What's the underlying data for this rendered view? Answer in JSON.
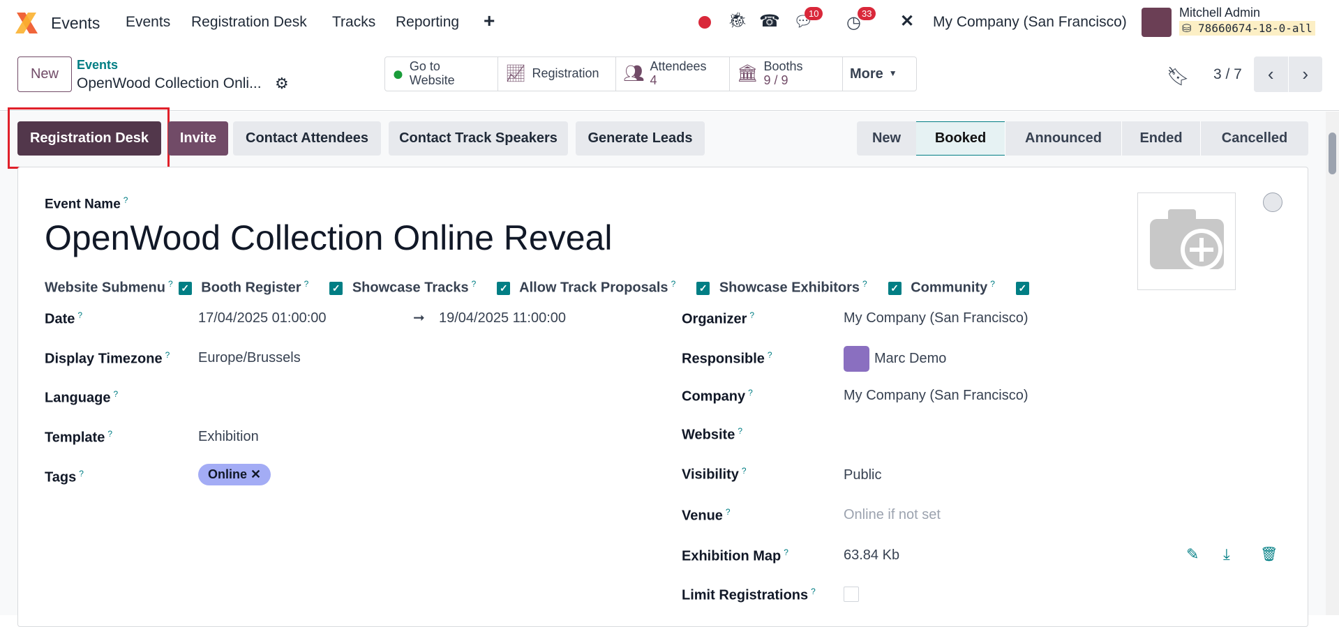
{
  "nav": {
    "app": "Events",
    "menu": [
      "Events",
      "Registration Desk",
      "Tracks",
      "Reporting"
    ],
    "plus": "+",
    "chat_badge": "10",
    "activity_badge": "33",
    "company": "My Company (San Francisco)",
    "user": "Mitchell Admin",
    "db": "78660674-18-0-all"
  },
  "control": {
    "new_label": "New",
    "breadcrumb_parent": "Events",
    "breadcrumb_current": "OpenWood Collection Onli...",
    "pager": "3 / 7",
    "smart": [
      {
        "label": "Go to",
        "label2": "Website",
        "icon": "globe-icon"
      },
      {
        "label": "Registration",
        "icon": "chart-icon"
      },
      {
        "label": "Attendees",
        "value": "4",
        "icon": "users-icon"
      },
      {
        "label": "Booths",
        "value": "9 / 9",
        "icon": "bank-icon"
      },
      {
        "label": "More"
      }
    ]
  },
  "actions": {
    "registration_desk": "Registration Desk",
    "invite": "Invite",
    "contact_attendees": "Contact Attendees",
    "contact_track_speakers": "Contact Track Speakers",
    "generate_leads": "Generate Leads"
  },
  "status": {
    "stages": [
      "New",
      "Booked",
      "Announced",
      "Ended",
      "Cancelled"
    ],
    "active": "Booked"
  },
  "form": {
    "event_name_label": "Event Name",
    "event_name": "OpenWood Collection Online Reveal",
    "checks": [
      "Website Submenu",
      "Booth Register",
      "Showcase Tracks",
      "Allow Track Proposals",
      "Showcase Exhibitors",
      "Community"
    ],
    "left": [
      {
        "label": "Date",
        "value": "17/04/2025 01:00:00",
        "value2": "19/04/2025 11:00:00"
      },
      {
        "label": "Display Timezone",
        "value": "Europe/Brussels"
      },
      {
        "label": "Language",
        "value": ""
      },
      {
        "label": "Template",
        "value": "Exhibition"
      },
      {
        "label": "Tags",
        "value": "Online"
      }
    ],
    "right": [
      {
        "label": "Organizer",
        "value": "My Company (San Francisco)"
      },
      {
        "label": "Responsible",
        "value": "Marc Demo"
      },
      {
        "label": "Company",
        "value": "My Company (San Francisco)"
      },
      {
        "label": "Website",
        "value": ""
      },
      {
        "label": "Visibility",
        "value": "Public"
      },
      {
        "label": "Venue",
        "value": "Online if not set"
      },
      {
        "label": "Exhibition Map",
        "value": "63.84 Kb"
      },
      {
        "label": "Limit Registrations",
        "value": ""
      }
    ]
  },
  "colors": {
    "primary": "#714b67",
    "teal": "#017e84",
    "highlight": "#e0202a"
  }
}
